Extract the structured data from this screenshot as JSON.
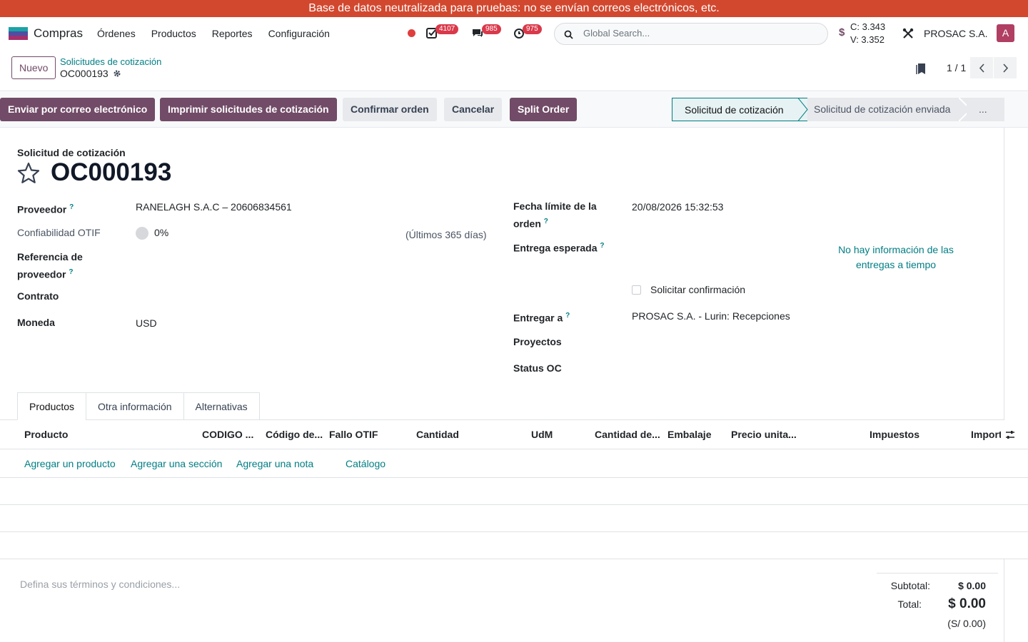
{
  "banner": "Base de datos neutralizada para pruebas: no se envían correos electrónicos, etc.",
  "navbar": {
    "app_name": "Compras",
    "menu": [
      "Órdenes",
      "Productos",
      "Reportes",
      "Configuración"
    ],
    "badges": {
      "activities": "4107",
      "messages": "985",
      "timers": "975"
    },
    "search_placeholder": "Global Search...",
    "currency_sign": "$",
    "rate_buy": "C: 3.343",
    "rate_sell": "V: 3.352",
    "company": "PROSAC S.A.",
    "avatar_letter": "A"
  },
  "control": {
    "new_label": "Nuevo",
    "breadcrumb_parent": "Solicitudes de cotización",
    "breadcrumb_current": "OC000193",
    "pager": "1 / 1"
  },
  "actions": {
    "send_email": "Enviar por correo electrónico",
    "print": "Imprimir solicitudes de cotización",
    "confirm": "Confirmar orden",
    "cancel": "Cancelar",
    "split": "Split Order"
  },
  "stages": {
    "current": "Solicitud de cotización",
    "next": "Solicitud de cotización enviada",
    "more": "..."
  },
  "form": {
    "doc_label": "Solicitud de cotización",
    "doc_name": "OC000193",
    "vendor_label": "Proveedor",
    "vendor_value": "RANELAGH S.A.C – 20606834561",
    "otif_label": "Confiabilidad OTIF",
    "otif_value": "0%",
    "otif_period": "(Últimos 365 días)",
    "vendor_ref_label_1": "Referencia de",
    "vendor_ref_label_2": "proveedor",
    "contract_label": "Contrato",
    "currency_label": "Moneda",
    "currency_value": "USD",
    "deadline_label_1": "Fecha límite de la",
    "deadline_label_2": "orden",
    "deadline_value": "20/08/2026 15:32:53",
    "expected_label": "Entrega esperada",
    "ontime_info_1": "No hay información de las",
    "ontime_info_2": "entregas a tiempo",
    "request_confirm": "Solicitar confirmación",
    "deliver_to_label": "Entregar a",
    "deliver_to_value": "PROSAC S.A. - Lurin: Recepciones",
    "projects_label": "Proyectos",
    "status_label": "Status OC"
  },
  "tabs": [
    "Productos",
    "Otra información",
    "Alternativas"
  ],
  "table": {
    "headers": [
      "Producto",
      "CODIGO ...",
      "Código de...",
      "Fallo OTIF",
      "Cantidad",
      "UdM",
      "Cantidad de...",
      "Embalaje",
      "Precio unita...",
      "Impuestos",
      "Import"
    ],
    "add_links": [
      "Agregar un producto",
      "Agregar una sección",
      "Agregar una nota",
      "Catálogo"
    ]
  },
  "footer": {
    "terms_placeholder": "Defina sus términos y condiciones...",
    "subtotal_label": "Subtotal:",
    "subtotal_value": "$ 0.00",
    "total_label": "Total:",
    "total_value": "$ 0.00",
    "local_total": "(S/ 0.00)"
  }
}
